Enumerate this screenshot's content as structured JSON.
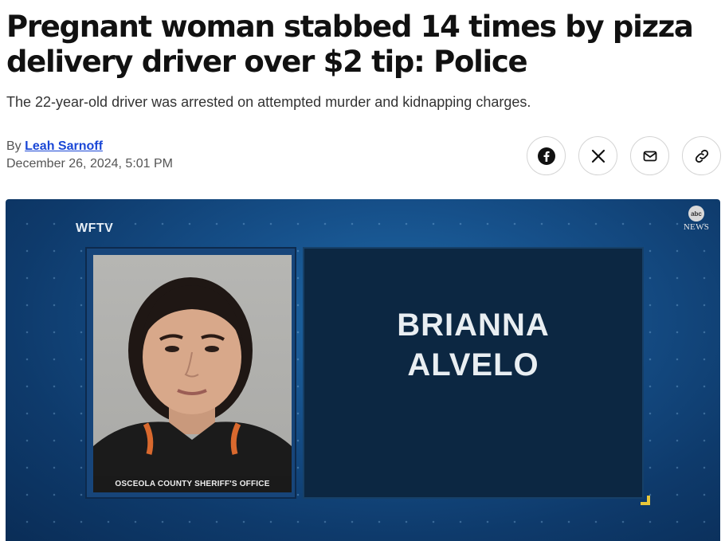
{
  "article": {
    "headline": "Pregnant woman stabbed 14 times by pizza delivery driver over $2 tip: Police",
    "dek": "The 22-year-old driver was arrested on attempted murder and kidnapping charges.",
    "byline_prefix": "By",
    "author": "Leah Sarnoff",
    "date": "December 26, 2024, 5:01 PM"
  },
  "share": [
    {
      "name": "facebook-share-button",
      "icon": "facebook-icon"
    },
    {
      "name": "x-share-button",
      "icon": "x-icon"
    },
    {
      "name": "email-share-button",
      "icon": "mail-icon"
    },
    {
      "name": "copy-link-button",
      "icon": "link-icon"
    }
  ],
  "hero": {
    "station": "WFTV",
    "network_logo": "abc",
    "network_label": "NEWS",
    "mugshot_caption": "OSCEOLA COUNTY SHERIFF'S OFFICE",
    "name_line1": "BRIANNA",
    "name_line2": "ALVELO",
    "accent_color": "#e8c63a"
  }
}
